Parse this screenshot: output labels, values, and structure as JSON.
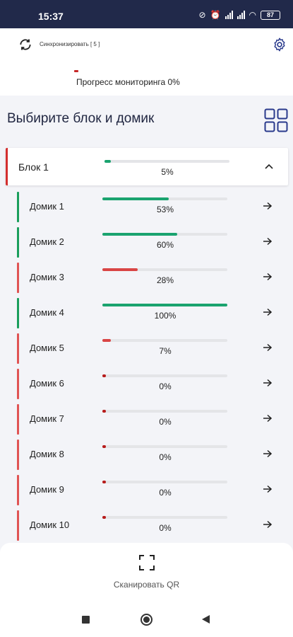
{
  "statusbar": {
    "time": "15:37",
    "battery": "87"
  },
  "topbar": {
    "sync_label": "Синхронизировать [ 5 ]",
    "monitoring_label": "Прогресс мониторинга 0%"
  },
  "main": {
    "title": "Выбирите блок и домик"
  },
  "block": {
    "name": "Блок 1",
    "progress": 5,
    "progress_label": "5%",
    "status_color": "#d32f2f"
  },
  "colors": {
    "good": "#1aa36f",
    "bad": "#d94545",
    "accent_green": "#1a9e5c",
    "accent_red": "#e05454",
    "track": "#e4e5e8"
  },
  "houses": [
    {
      "name": "Домик 1",
      "progress": 53,
      "label": "53%",
      "status": "good"
    },
    {
      "name": "Домик 2",
      "progress": 60,
      "label": "60%",
      "status": "good"
    },
    {
      "name": "Домик 3",
      "progress": 28,
      "label": "28%",
      "status": "bad"
    },
    {
      "name": "Домик 4",
      "progress": 100,
      "label": "100%",
      "status": "good"
    },
    {
      "name": "Домик 5",
      "progress": 7,
      "label": "7%",
      "status": "bad"
    },
    {
      "name": "Домик 6",
      "progress": 0,
      "label": "0%",
      "status": "bad"
    },
    {
      "name": "Домик 7",
      "progress": 0,
      "label": "0%",
      "status": "bad"
    },
    {
      "name": "Домик 8",
      "progress": 0,
      "label": "0%",
      "status": "bad"
    },
    {
      "name": "Домик 9",
      "progress": 0,
      "label": "0%",
      "status": "bad"
    },
    {
      "name": "Домик 10",
      "progress": 0,
      "label": "0%",
      "status": "bad"
    }
  ],
  "bottom": {
    "scan_label": "Сканировать QR"
  }
}
